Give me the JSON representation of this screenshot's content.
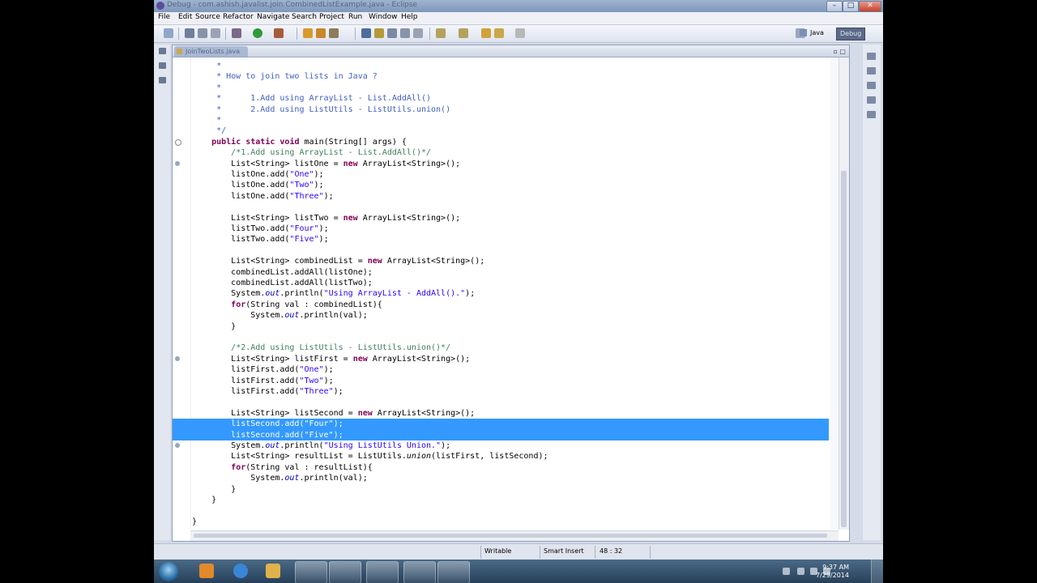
{
  "window": {
    "title": "Debug - com.ashish.javalist.join.CombinedListExample.java - Eclipse",
    "buttons": {
      "minimize": "–",
      "maximize": "□",
      "close": "✕"
    }
  },
  "menu": [
    "File",
    "Edit",
    "Source",
    "Refactor",
    "Navigate",
    "Search",
    "Project",
    "Run",
    "Window",
    "Help"
  ],
  "perspectives": {
    "java": "Java",
    "debug": "Debug"
  },
  "editor": {
    "tab_label": "JoinTwoLists.java",
    "code_lines": [
      "     *",
      "     * How to join two lists in Java ?",
      "     *",
      "     *      1.Add using ArrayList - List.AddAll()",
      "     *      2.Add using ListUtils - ListUtils.union()",
      "     *",
      "     */",
      "    public static void main(String[] args) {",
      "        /*1.Add using ArrayList - List.AddAll()*/",
      "        List<String> listOne = new ArrayList<String>();",
      "        listOne.add(\"One\");",
      "        listOne.add(\"Two\");",
      "        listOne.add(\"Three\");",
      "",
      "        List<String> listTwo = new ArrayList<String>();",
      "        listTwo.add(\"Four\");",
      "        listTwo.add(\"Five\");",
      "",
      "        List<String> combinedList = new ArrayList<String>();",
      "        combinedList.addAll(listOne);",
      "        combinedList.addAll(listTwo);",
      "        System.out.println(\"Using ArrayList - AddAll().\");",
      "        for(String val : combinedList){",
      "            System.out.println(val);",
      "        }",
      "",
      "        /*2.Add using ListUtils - ListUtils.union()*/",
      "        List<String> listFirst = new ArrayList<String>();",
      "        listFirst.add(\"One\");",
      "        listFirst.add(\"Two\");",
      "        listFirst.add(\"Three\");",
      "",
      "        List<String> listSecond = new ArrayList<String>();",
      "        listSecond.add(\"Four\");",
      "        listSecond.add(\"Five\");",
      "        System.out.println(\"Using ListUtils Union.\");",
      "        List<String> resultList = ListUtils.union(listFirst, listSecond);",
      "        for(String val : resultList){",
      "            System.out.println(val);",
      "        }",
      "    }",
      "",
      "}"
    ],
    "selected_lines": [
      33,
      34
    ]
  },
  "status": {
    "writable": "Writable",
    "insert_mode": "Smart Insert",
    "position": "48 : 32"
  },
  "clock": {
    "time": "9:37 AM",
    "date": "7/29/2014"
  },
  "colors": {
    "selection": "#3399ff",
    "keyword": "#7f0055",
    "comment": "#3f7f5f",
    "javadoc": "#3f5fbf",
    "string": "#2a00ff"
  }
}
